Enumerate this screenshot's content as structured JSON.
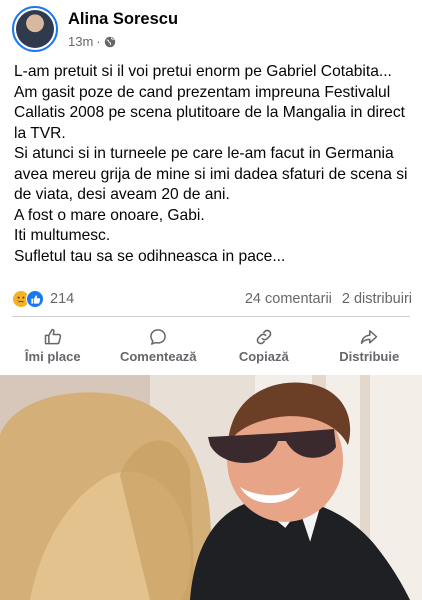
{
  "post": {
    "author": "Alina Sorescu",
    "time": "13m",
    "dot": "·",
    "text_lines": [
      "L-am pretuit si il voi pretui enorm pe Gabriel Cotabita...",
      "Am gasit poze de cand prezentam impreuna Festivalul Callatis 2008 pe scena plutitoare de la Mangalia in direct la TVR.",
      "Si atunci si in turneele pe care le-am facut in Germania avea mereu grija de mine si imi dadea sfaturi de scena si de viata, desi aveam 20 de ani.",
      "A fost o mare onoare, Gabi.",
      "Iti multumesc.",
      "Sufletul tau sa se odihneasca in pace..."
    ]
  },
  "stats": {
    "reactions_count": "214",
    "comments": "24 comentarii",
    "shares": "2 distribuiri"
  },
  "actions": {
    "like": "Îmi place",
    "comment": "Comentează",
    "copy": "Copiază",
    "share": "Distribuie"
  },
  "colors": {
    "accent": "#1877f2",
    "muted": "#65676b",
    "text": "#050505"
  }
}
